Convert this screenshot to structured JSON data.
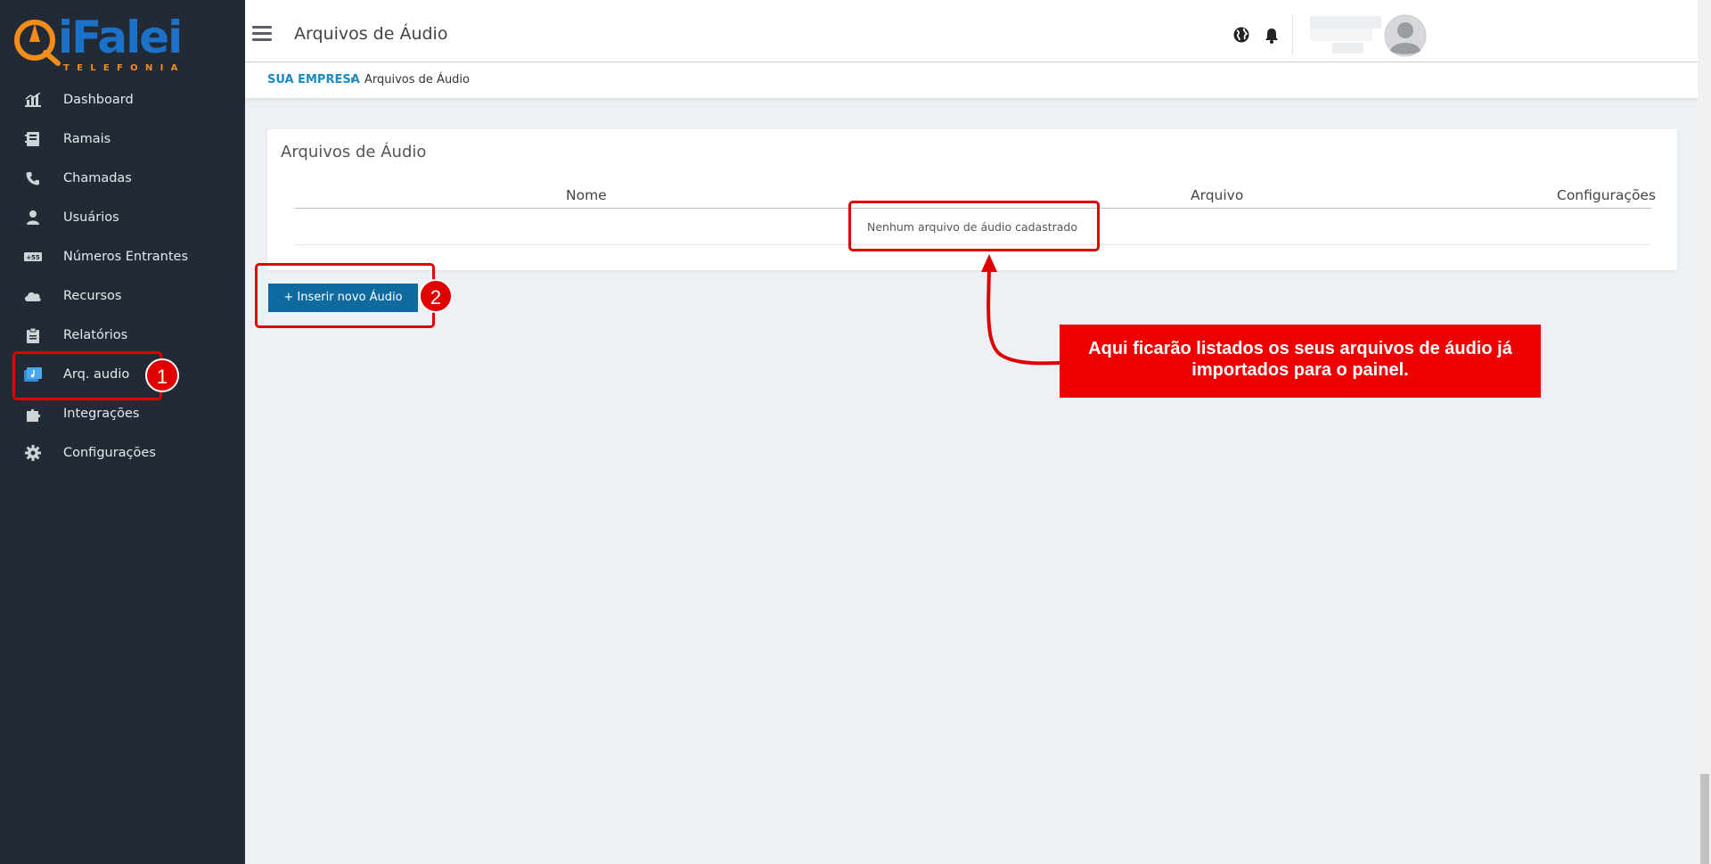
{
  "brand": {
    "logo_text": "iFalei",
    "logo_subtitle": "TELEFONIA",
    "colors": {
      "primary": "#1c72c8",
      "accent": "#f28c1b"
    }
  },
  "sidebar": {
    "items": [
      {
        "label": "Dashboard",
        "icon": "chart-icon"
      },
      {
        "label": "Ramais",
        "icon": "phonebook-icon"
      },
      {
        "label": "Chamadas",
        "icon": "phone-icon"
      },
      {
        "label": "Usuários",
        "icon": "user-icon"
      },
      {
        "label": "Números Entrantes",
        "icon": "number-badge-icon"
      },
      {
        "label": "Recursos",
        "icon": "cloud-icon"
      },
      {
        "label": "Relatórios",
        "icon": "clipboard-icon"
      },
      {
        "label": "Arq. audio",
        "icon": "audio-folder-icon"
      },
      {
        "label": "Integrações",
        "icon": "puzzle-icon"
      },
      {
        "label": "Configurações",
        "icon": "gear-icon"
      }
    ]
  },
  "header": {
    "title": "Arquivos de Áudio",
    "icons": [
      "menu-icon",
      "globe-icon",
      "bell-icon",
      "avatar"
    ]
  },
  "breadcrumb": {
    "root": "SUA EMPRESA",
    "separator": "▸",
    "current": "Arquivos de Áudio"
  },
  "card": {
    "title": "Arquivos de Áudio",
    "columns": [
      "Nome",
      "Arquivo",
      "Configurações"
    ],
    "empty_message": "Nenhum arquivo de áudio cadastrado"
  },
  "actions": {
    "insert_label": "+ Inserir novo Áudio",
    "button_color": "#0f6aa0"
  },
  "annotations": {
    "badge_1": "1",
    "badge_2": "2",
    "callout": "Aqui ficarão listados os seus arquivos de áudio já importados para o painel.",
    "color": "#e00000"
  }
}
